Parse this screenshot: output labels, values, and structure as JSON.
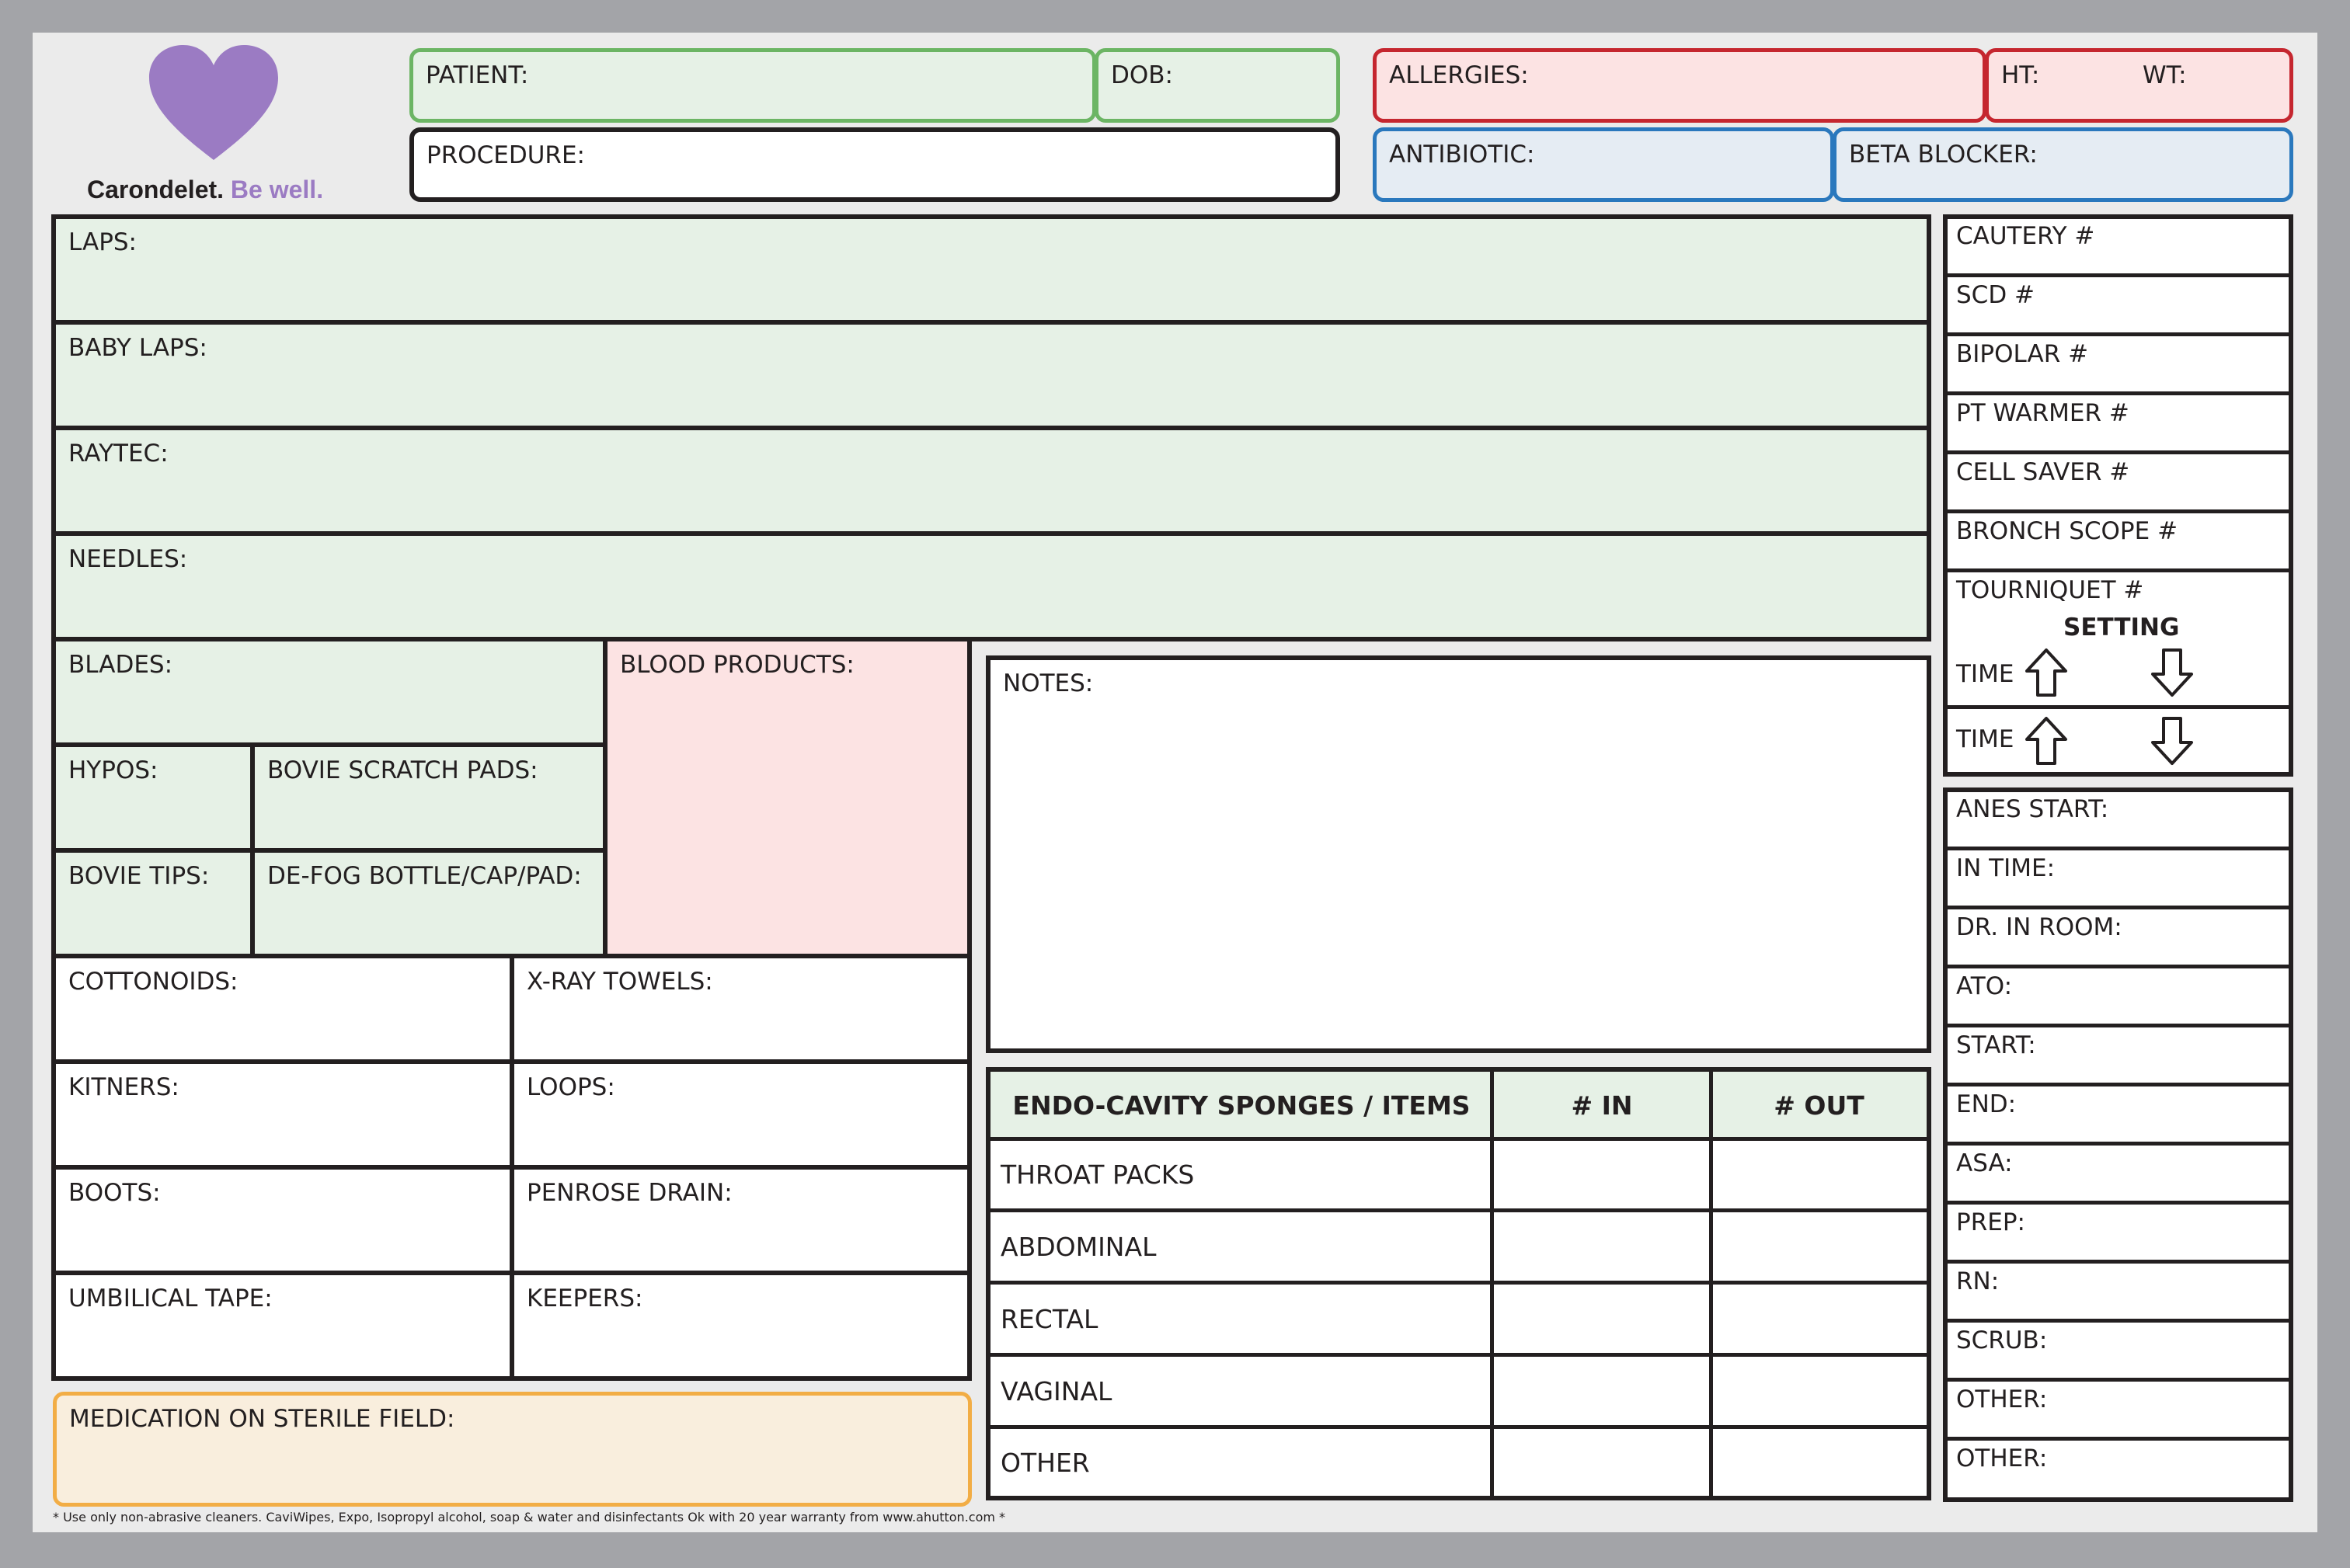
{
  "brand": {
    "name": "Carondelet.",
    "tagline": "Be well.",
    "heart_color": "#9b7bc3"
  },
  "header": {
    "patient": "PATIENT:",
    "dob": "DOB:",
    "procedure": "PROCEDURE:",
    "allergies": "ALLERGIES:",
    "ht": "HT:",
    "wt": "WT:",
    "antibiotic": "ANTIBIOTIC:",
    "beta_blocker": "BETA BLOCKER:"
  },
  "counts": {
    "laps": "LAPS:",
    "baby_laps": "BABY LAPS:",
    "raytec": "RAYTEC:",
    "needles": "NEEDLES:",
    "blades": "BLADES:",
    "blood_products": "BLOOD PRODUCTS:",
    "hypos": "HYPOS:",
    "bovie_scratch_pads": "BOVIE SCRATCH PADS:",
    "bovie_tips": "BOVIE TIPS:",
    "defog": "DE-FOG BOTTLE/CAP/PAD:",
    "cottonoids": "COTTONOIDS:",
    "xray_towels": "X-RAY TOWELS:",
    "kitners": "KITNERS:",
    "loops": "LOOPS:",
    "boots": "BOOTS:",
    "penrose": "PENROSE DRAIN:",
    "umbilical": "UMBILICAL TAPE:",
    "keepers": "KEEPERS:",
    "medication": "MEDICATION ON STERILE FIELD:"
  },
  "notes": {
    "label": "NOTES:"
  },
  "endo_table": {
    "headers": [
      "ENDO-CAVITY SPONGES / ITEMS",
      "# IN",
      "# OUT"
    ],
    "rows": [
      "THROAT PACKS",
      "ABDOMINAL",
      "RECTAL",
      "VAGINAL",
      "OTHER"
    ]
  },
  "equipment": {
    "items": [
      "CAUTERY #",
      "SCD #",
      "BIPOLAR #",
      "PT WARMER #",
      "CELL SAVER #",
      "BRONCH SCOPE #"
    ],
    "tourniquet": "TOURNIQUET #",
    "setting": "SETTING",
    "time_label": "TIME"
  },
  "times": {
    "items": [
      "ANES START:",
      "IN TIME:",
      "DR. IN ROOM:",
      "ATO:",
      "START:",
      "END:",
      "ASA:",
      "PREP:",
      "RN:",
      "SCRUB:",
      "OTHER:",
      "OTHER:"
    ]
  },
  "footnote": "* Use only non-abrasive cleaners. CaviWipes, Expo, Isopropyl alcohol, soap & water and disinfectants Ok with 20 year warranty from www.ahutton.com *",
  "colors": {
    "green_border": "#6cb564",
    "red_border": "#c5262f",
    "blue_border": "#2a78bd",
    "orange_border": "#f2ad45"
  }
}
